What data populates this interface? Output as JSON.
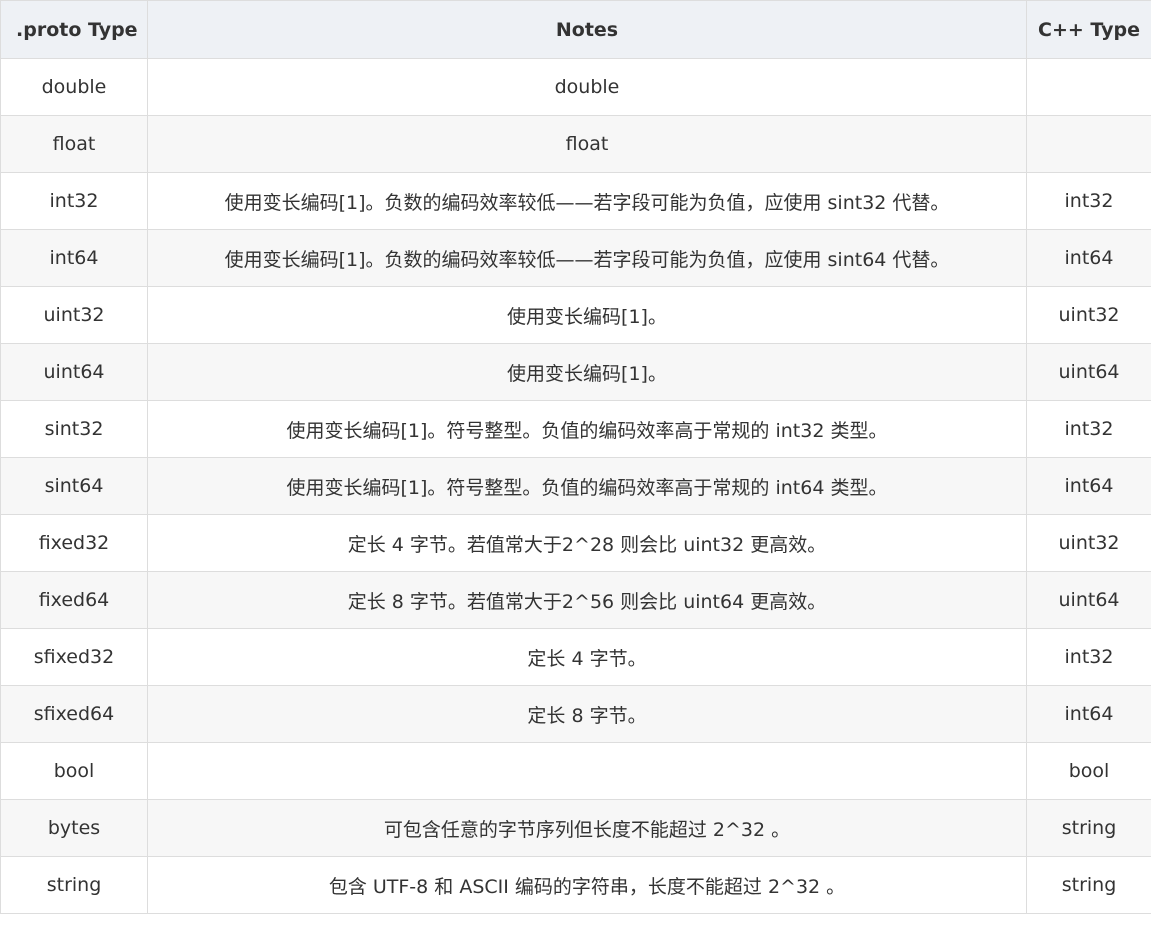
{
  "table": {
    "headers": [
      ".proto Type",
      "Notes",
      "C++ Type"
    ],
    "rows": [
      {
        "proto": "double",
        "notes": "double",
        "cpp": ""
      },
      {
        "proto": "float",
        "notes": "float",
        "cpp": ""
      },
      {
        "proto": "int32",
        "notes": "使用变长编码[1]。负数的编码效率较低——若字段可能为负值，应使用 sint32 代替。",
        "cpp": "int32"
      },
      {
        "proto": "int64",
        "notes": "使用变长编码[1]。负数的编码效率较低——若字段可能为负值，应使用 sint64 代替。",
        "cpp": "int64"
      },
      {
        "proto": "uint32",
        "notes": "使用变长编码[1]。",
        "cpp": "uint32"
      },
      {
        "proto": "uint64",
        "notes": "使用变长编码[1]。",
        "cpp": "uint64"
      },
      {
        "proto": "sint32",
        "notes": "使用变长编码[1]。符号整型。负值的编码效率高于常规的 int32 类型。",
        "cpp": "int32"
      },
      {
        "proto": "sint64",
        "notes": "使用变长编码[1]。符号整型。负值的编码效率高于常规的 int64 类型。",
        "cpp": "int64"
      },
      {
        "proto": "fixed32",
        "notes": "定长 4 字节。若值常大于2^28 则会比 uint32 更高效。",
        "cpp": "uint32"
      },
      {
        "proto": "fixed64",
        "notes": "定长 8 字节。若值常大于2^56 则会比 uint64 更高效。",
        "cpp": "uint64"
      },
      {
        "proto": "sfixed32",
        "notes": "定长 4 字节。",
        "cpp": "int32"
      },
      {
        "proto": "sfixed64",
        "notes": "定长 8 字节。",
        "cpp": "int64"
      },
      {
        "proto": "bool",
        "notes": "",
        "cpp": "bool"
      },
      {
        "proto": "bytes",
        "notes": "可包含任意的字节序列但长度不能超过 2^32 。",
        "cpp": "string"
      },
      {
        "proto": "string",
        "notes": "包含 UTF-8 和 ASCII 编码的字符串，长度不能超过 2^32 。",
        "cpp": "string"
      }
    ]
  }
}
